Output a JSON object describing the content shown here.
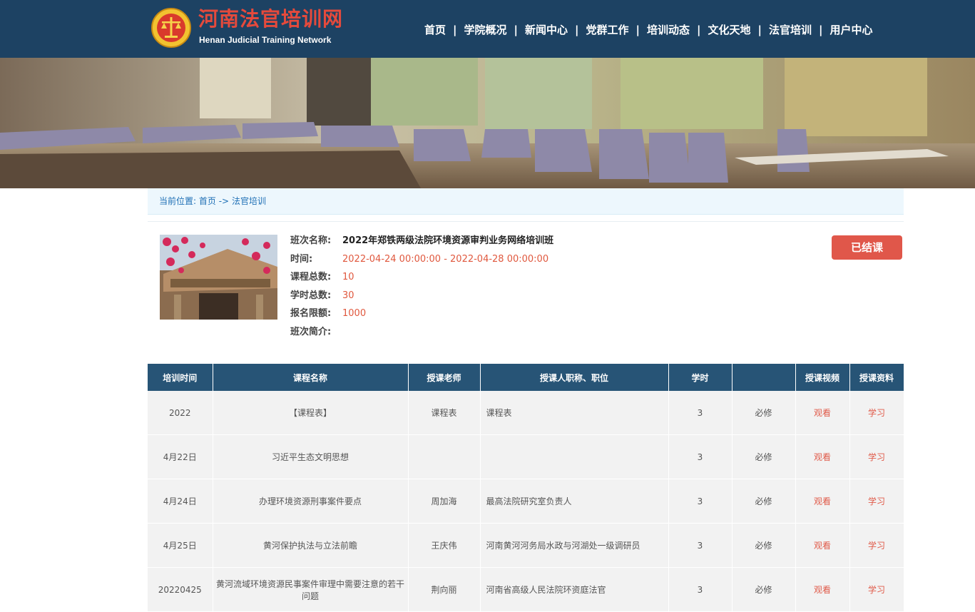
{
  "header": {
    "title": "河南法官培训网",
    "subtitle": "Henan Judicial Training Network",
    "nav": [
      "首页",
      "学院概况",
      "新闻中心",
      "党群工作",
      "培训动态",
      "文化天地",
      "法官培训",
      "用户中心"
    ],
    "nav_separator": "|"
  },
  "breadcrumb": {
    "prefix": "当前位置:",
    "home": "首页",
    "arrow": "->",
    "current": "法官培训"
  },
  "class_info": {
    "name_label": "班次名称:",
    "name": "2022年郑铁两级法院环境资源审判业务网络培训班",
    "time_label": "时间:",
    "time": "2022-04-24 00:00:00 - 2022-04-28 00:00:00",
    "total_courses_label": "课程总数:",
    "total_courses": "10",
    "total_hours_label": "学时总数:",
    "total_hours": "30",
    "limit_label": "报名限额:",
    "limit": "1000",
    "intro_label": "班次简介:",
    "intro": "",
    "status_button": "已结课"
  },
  "table": {
    "headers": [
      "培训时间",
      "课程名称",
      "授课老师",
      "授课人职称、职位",
      "学时",
      "",
      "授课视频",
      "授课资料"
    ],
    "rows": [
      {
        "date": "2022",
        "course": "【课程表】",
        "teacher": "课程表",
        "position": "课程表",
        "hours": "3",
        "type": "必修",
        "video": "观看",
        "material": "学习"
      },
      {
        "date": "4月22日",
        "course": "习近平生态文明思想",
        "teacher": "",
        "position": "",
        "hours": "3",
        "type": "必修",
        "video": "观看",
        "material": "学习"
      },
      {
        "date": "4月24日",
        "course": "办理环境资源刑事案件要点",
        "teacher": "周加海",
        "position": "最高法院研究室负责人",
        "hours": "3",
        "type": "必修",
        "video": "观看",
        "material": "学习"
      },
      {
        "date": "4月25日",
        "course": "黄河保护执法与立法前瞻",
        "teacher": "王庆伟",
        "position": "河南黄河河务局水政与河湖处一级调研员",
        "hours": "3",
        "type": "必修",
        "video": "观看",
        "material": "学习"
      },
      {
        "date": "20220425",
        "course": "黄河流域环境资源民事案件审理中需要注意的若干问题",
        "teacher": "荆向丽",
        "position": "河南省高级人民法院环资庭法官",
        "hours": "3",
        "type": "必修",
        "video": "观看",
        "material": "学习"
      }
    ]
  },
  "colors": {
    "header_bg": "#1d4263",
    "title_red": "#e54a3c",
    "accent_red": "#e0583e",
    "table_header_bg": "#275476",
    "button_bg": "#e0574a"
  }
}
